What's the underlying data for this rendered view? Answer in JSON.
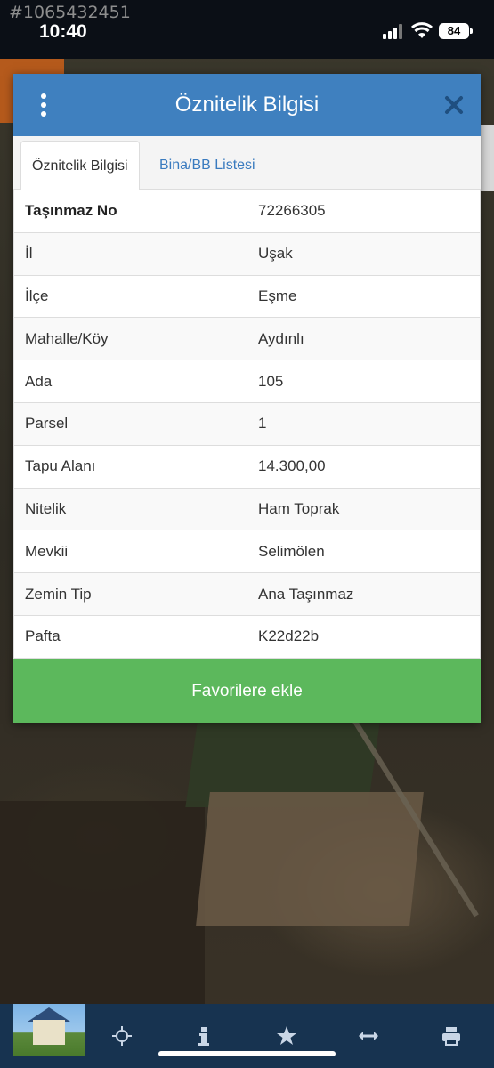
{
  "status_bar": {
    "watermark_id": "#1065432451",
    "time": "10:40",
    "battery": "84"
  },
  "dialog": {
    "title": "Öznitelik Bilgisi",
    "tabs": [
      {
        "label": "Öznitelik Bilgisi",
        "active": true
      },
      {
        "label": "Bina/BB Listesi",
        "active": false
      }
    ],
    "rows": [
      {
        "key": "Taşınmaz No",
        "value": "72266305"
      },
      {
        "key": "İl",
        "value": "Uşak"
      },
      {
        "key": "İlçe",
        "value": "Eşme"
      },
      {
        "key": "Mahalle/Köy",
        "value": "Aydınlı"
      },
      {
        "key": "Ada",
        "value": "105"
      },
      {
        "key": "Parsel",
        "value": "1"
      },
      {
        "key": "Tapu Alanı",
        "value": "14.300,00"
      },
      {
        "key": "Nitelik",
        "value": "Ham Toprak"
      },
      {
        "key": "Mevkii",
        "value": "Selimölen"
      },
      {
        "key": "Zemin Tip",
        "value": "Ana Taşınmaz"
      },
      {
        "key": "Pafta",
        "value": "K22d22b"
      }
    ],
    "favorite_button": "Favorilere ekle"
  },
  "toolbar": {
    "icons": [
      "move-icon",
      "info-icon",
      "star-icon",
      "measure-icon",
      "print-icon"
    ]
  },
  "colors": {
    "header_blue": "#3f80bf",
    "tab_link_blue": "#3a7bbf",
    "favorite_green": "#5cb85c",
    "toolbar_navy": "#173350"
  }
}
